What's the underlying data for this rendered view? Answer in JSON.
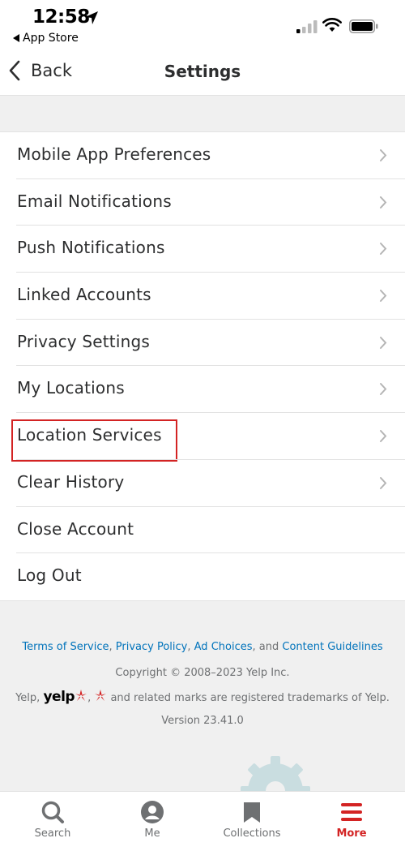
{
  "status_bar": {
    "time": "12:58",
    "back_app": "App Store",
    "icons": [
      "location-arrow-icon",
      "signal-icon",
      "wifi-icon",
      "battery-icon"
    ]
  },
  "nav": {
    "back_label": "Back",
    "title": "Settings"
  },
  "settings": {
    "items": [
      {
        "label": "Mobile App Preferences",
        "chevron": true
      },
      {
        "label": "Email Notifications",
        "chevron": true
      },
      {
        "label": "Push Notifications",
        "chevron": true
      },
      {
        "label": "Linked Accounts",
        "chevron": true
      },
      {
        "label": "Privacy Settings",
        "chevron": true
      },
      {
        "label": "My Locations",
        "chevron": true
      },
      {
        "label": "Location Services",
        "chevron": true,
        "highlighted": true
      },
      {
        "label": "Clear History",
        "chevron": true
      },
      {
        "label": "Close Account",
        "chevron": false
      },
      {
        "label": "Log Out",
        "chevron": false
      }
    ]
  },
  "footer": {
    "links": {
      "terms": "Terms of Service",
      "privacy": "Privacy Policy",
      "ad_choices": "Ad Choices",
      "and": "and",
      "guidelines": "Content Guidelines"
    },
    "copyright": "Copyright © 2008–2023 Yelp Inc.",
    "trademark_prefix": "Yelp,",
    "trademark_logo_text": "yelp",
    "trademark_suffix": "and related marks are registered trademarks of Yelp.",
    "version": "Version 23.41.0"
  },
  "tabs": [
    {
      "label": "Search",
      "icon": "search-icon",
      "active": false
    },
    {
      "label": "Me",
      "icon": "profile-icon",
      "active": false
    },
    {
      "label": "Collections",
      "icon": "bookmark-icon",
      "active": false
    },
    {
      "label": "More",
      "icon": "menu-icon",
      "active": true
    }
  ],
  "colors": {
    "brand_red": "#d32323",
    "link_blue": "#0073bb",
    "text_dark": "#2d2e2f",
    "text_muted": "#6e7072",
    "background": "#f0f0f0"
  }
}
